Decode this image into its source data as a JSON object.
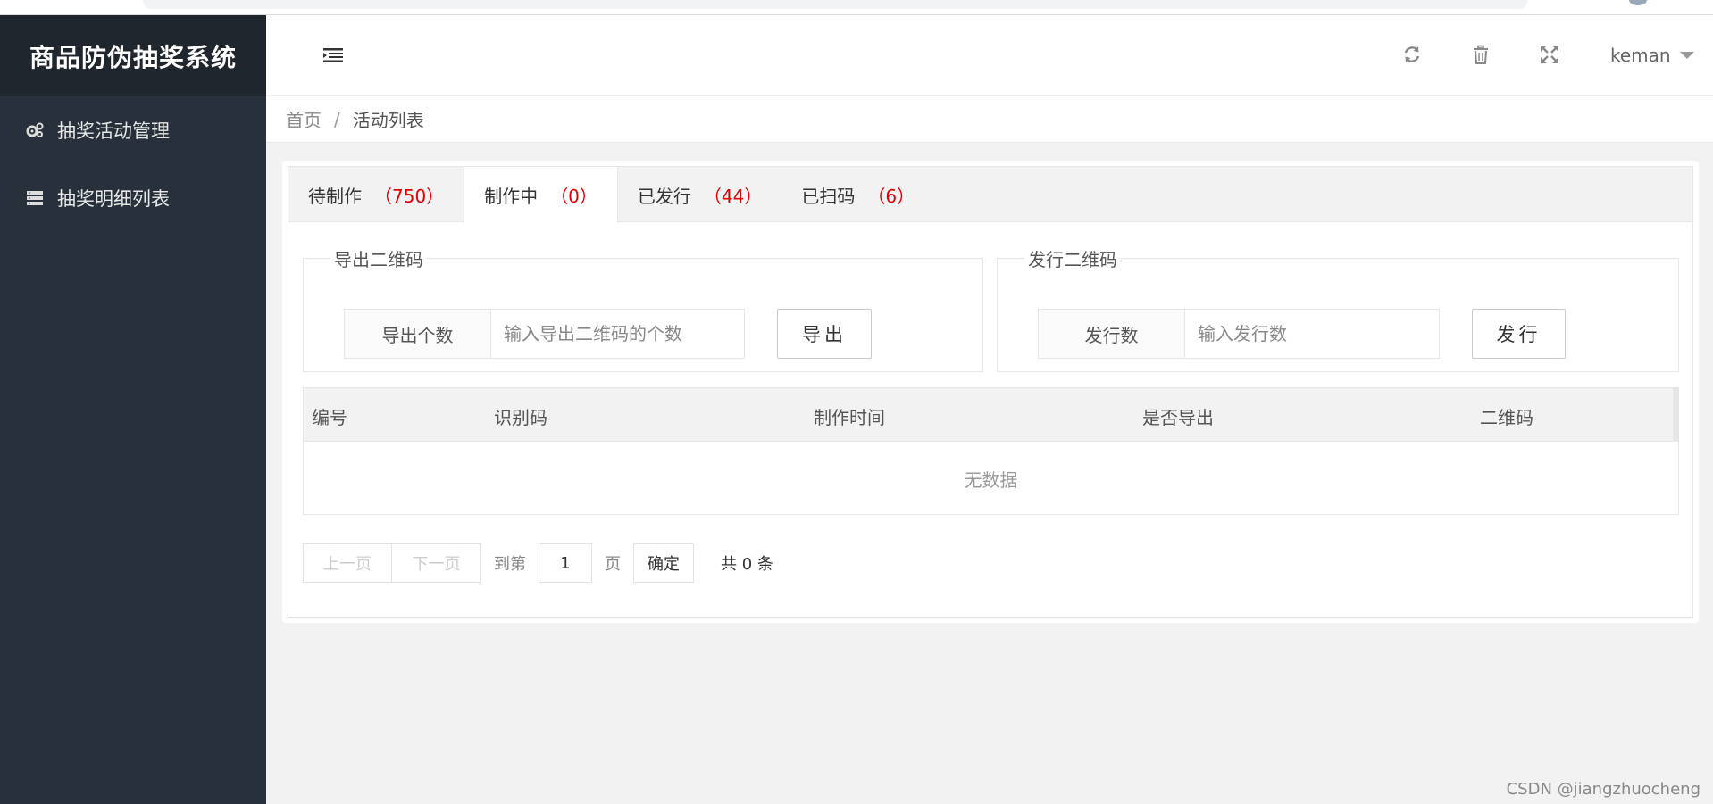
{
  "app": {
    "title": "商品防伪抽奖系统"
  },
  "sidebar": {
    "items": [
      {
        "label": "抽奖活动管理",
        "icon": "gears-icon"
      },
      {
        "label": "抽奖明细列表",
        "icon": "server-list-icon"
      }
    ]
  },
  "header": {
    "icons": [
      "menu-toggle-icon",
      "refresh-icon",
      "trash-icon",
      "fullscreen-icon"
    ],
    "user": "keman"
  },
  "breadcrumb": {
    "home": "首页",
    "separator": "/",
    "current": "活动列表"
  },
  "tabs": [
    {
      "label": "待制作",
      "count": "（750）"
    },
    {
      "label": "制作中",
      "count": "（0）"
    },
    {
      "label": "已发行",
      "count": "（44）"
    },
    {
      "label": "已扫码",
      "count": "（6）"
    }
  ],
  "export_box": {
    "legend": "导出二维码",
    "field_label": "导出个数",
    "placeholder": "输入导出二维码的个数",
    "button": "导出"
  },
  "issue_box": {
    "legend": "发行二维码",
    "field_label": "发行数",
    "placeholder": "输入发行数",
    "button": "发行"
  },
  "table": {
    "columns": [
      "编号",
      "识别码",
      "制作时间",
      "是否导出",
      "二维码"
    ],
    "empty_text": "无数据"
  },
  "pager": {
    "prev": "上一页",
    "next": "下一页",
    "goto_prefix": "到第",
    "page_value": "1",
    "goto_suffix": "页",
    "confirm": "确定",
    "total": "共 0 条"
  },
  "watermark": "CSDN @jiangzhuocheng",
  "colors": {
    "sidebar": "#28313b",
    "logo_bg": "#20262d",
    "count_red": "#e60000"
  }
}
